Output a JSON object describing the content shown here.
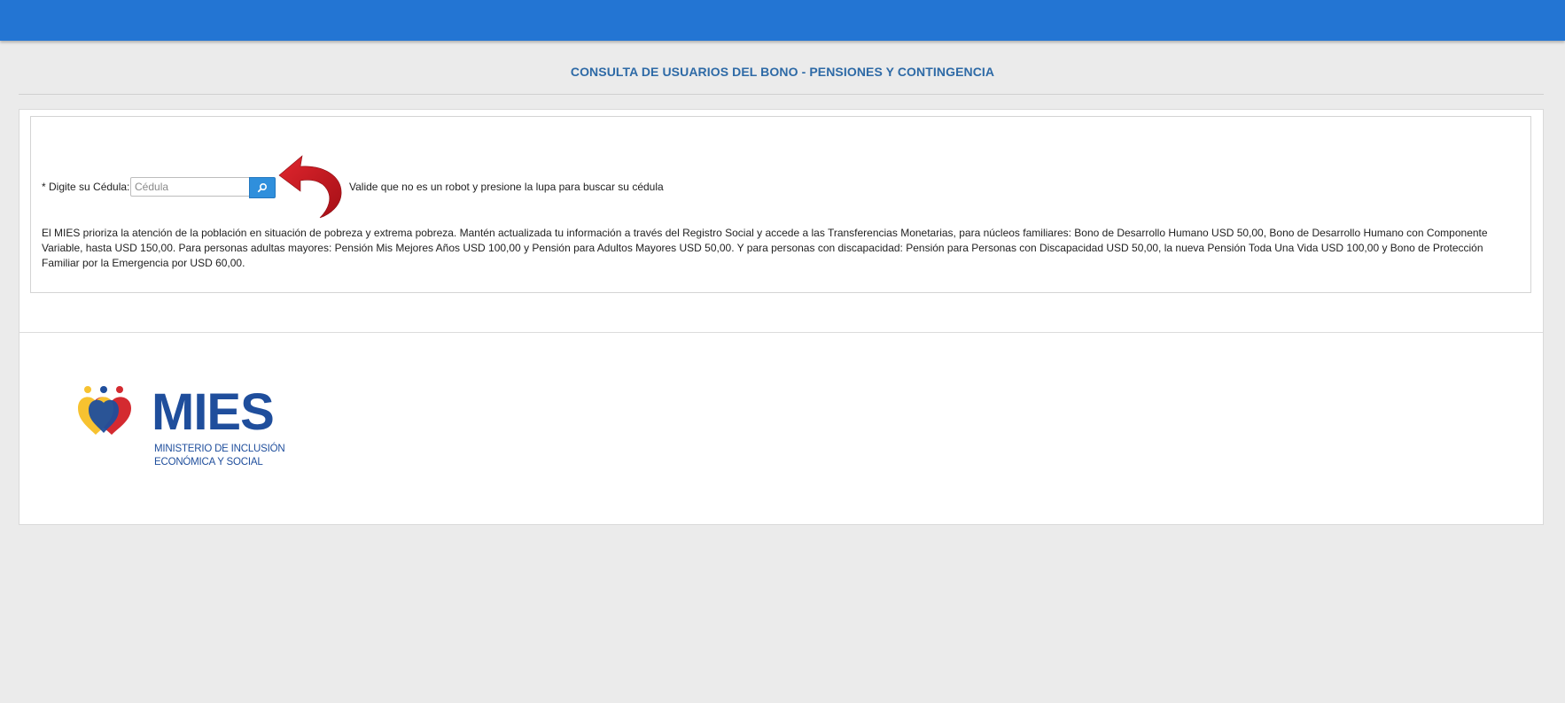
{
  "header": {
    "title": "CONSULTA DE USUARIOS DEL BONO - PENSIONES Y CONTINGENCIA",
    "bar_color": "#2375d3"
  },
  "form": {
    "label": "* Digite su Cédula:",
    "input_placeholder": "Cédula",
    "input_value": "",
    "search_icon": "search-icon",
    "hint": "Valide que no es un robot y presione la lupa para buscar su cédula"
  },
  "info": {
    "text": "El MIES prioriza la atención de la población en situación de pobreza y extrema pobreza. Mantén actualizada tu información a través del Registro Social y accede a las Transferencias Monetarias, para núcleos familiares: Bono de Desarrollo Humano USD 50,00, Bono de Desarrollo Humano con Componente Variable, hasta USD 150,00. Para personas adultas mayores: Pensión Mis Mejores Años USD 100,00 y Pensión para Adultos Mayores USD 50,00. Y para personas con discapacidad: Pensión para Personas con Discapacidad USD 50,00, la nueva Pensión Toda Una Vida USD 100,00 y Bono de Protección Familiar por la Emergencia por USD 60,00."
  },
  "logo": {
    "name": "MIES",
    "subtitle_line1": "MINISTERIO DE INCLUSIÓN",
    "subtitle_line2": "ECONÓMICA Y SOCIAL",
    "colors": {
      "navy": "#1f4e9c",
      "yellow": "#f7c230",
      "red": "#d42a30"
    }
  },
  "colors": {
    "accent": "#2f8fdc",
    "title_text": "#2e6aa6",
    "arrow": "#c8161d"
  }
}
